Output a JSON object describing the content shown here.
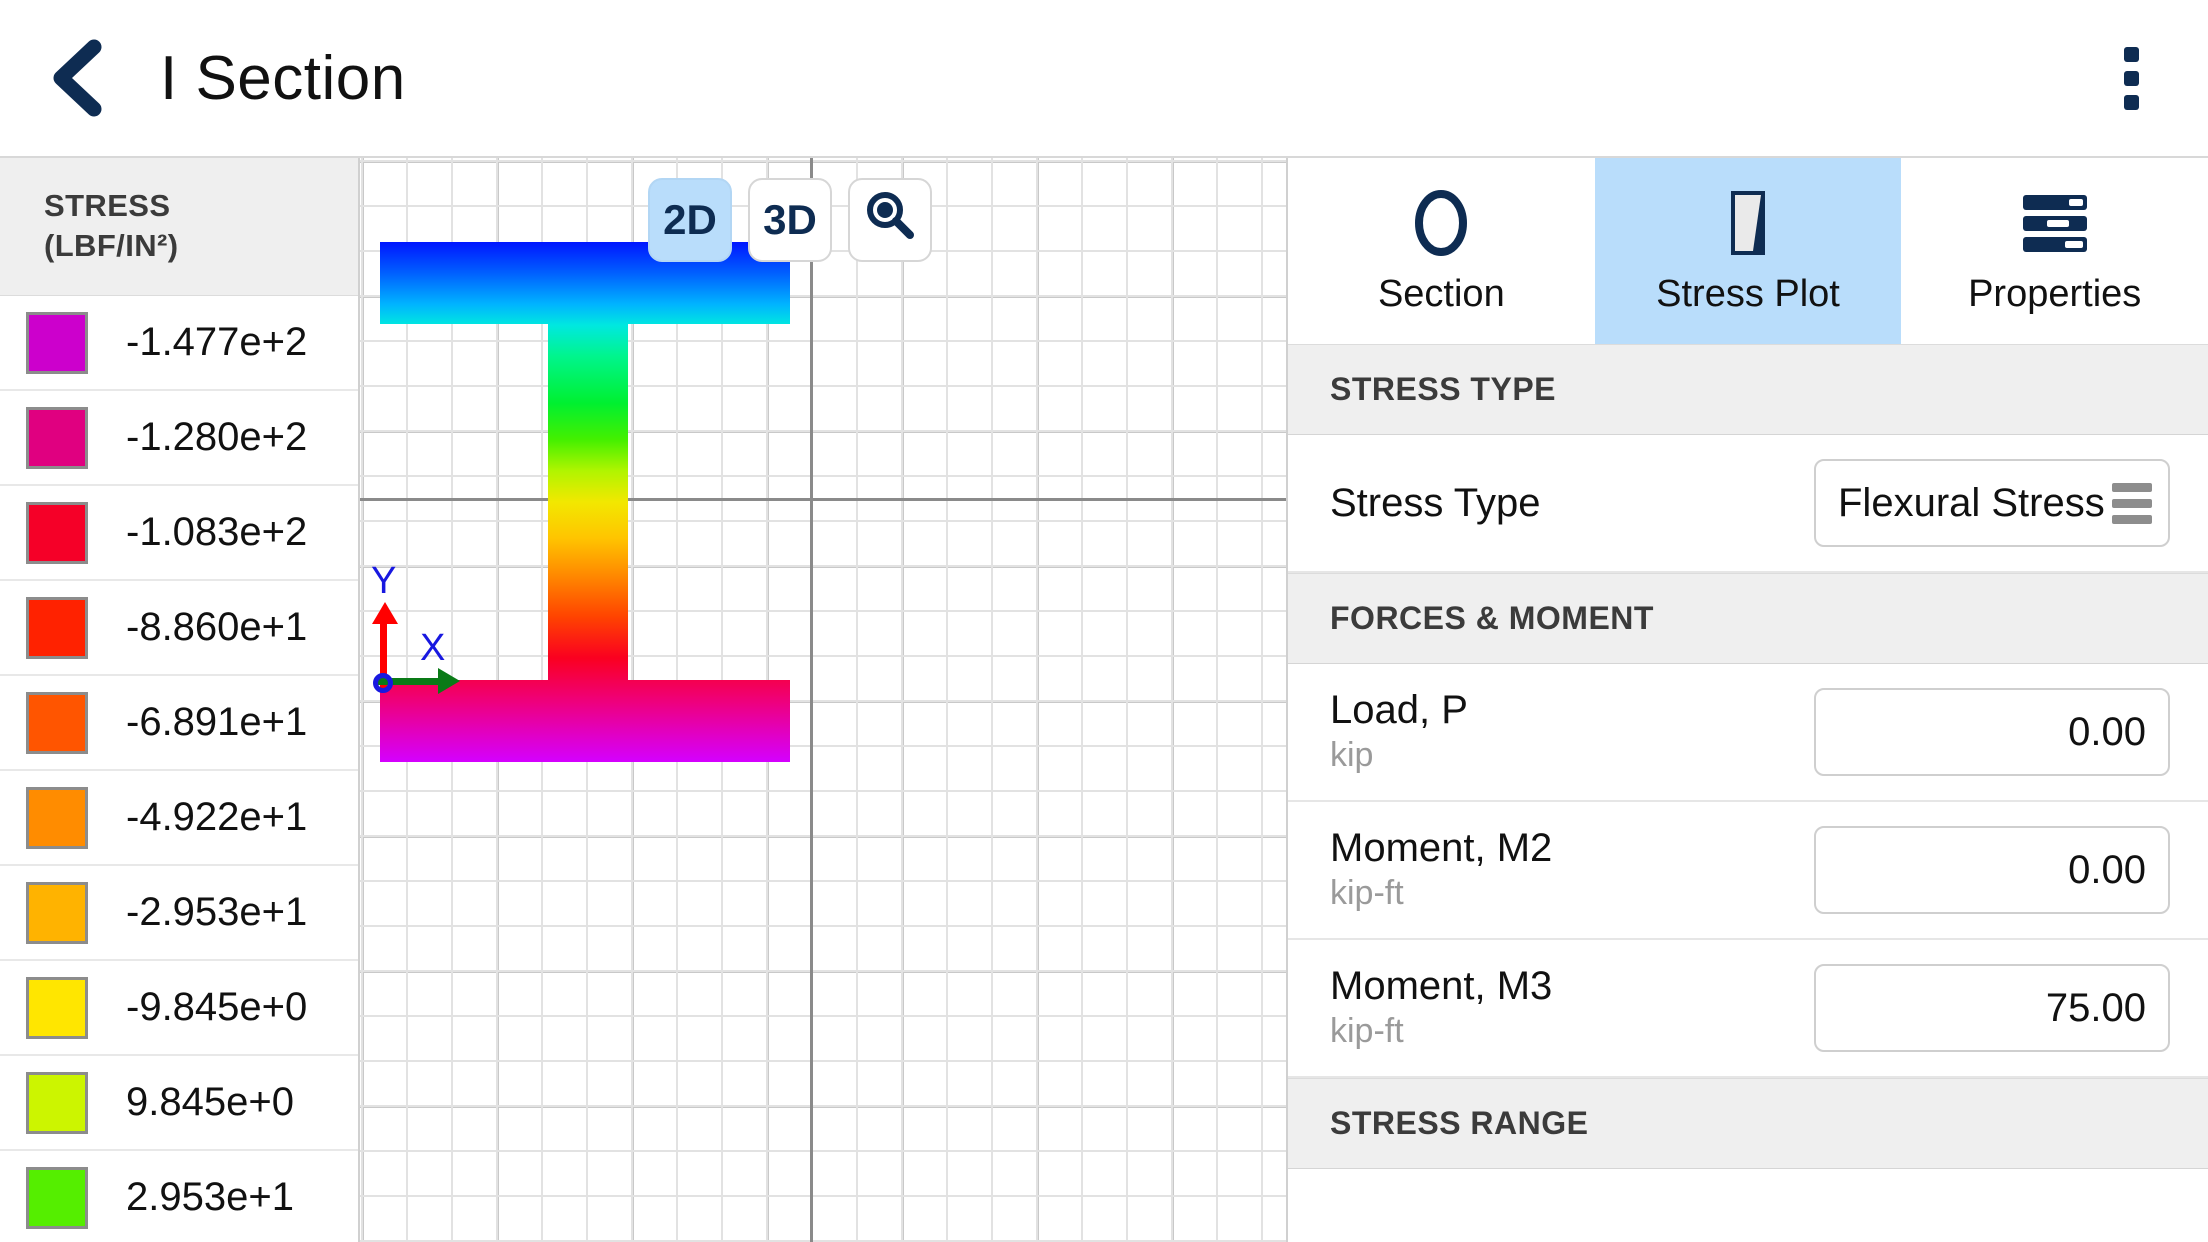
{
  "header": {
    "back_icon": "chevron-left-icon",
    "title": "I Section",
    "overflow_icon": "more-vertical-icon"
  },
  "legend": {
    "title_line1": "STRESS",
    "title_line2": "(LBF/IN²)",
    "rows": [
      {
        "color": "#cc00cc",
        "value": "-1.477e+2"
      },
      {
        "color": "#e00080",
        "value": "-1.280e+2"
      },
      {
        "color": "#f50028",
        "value": "-1.083e+2"
      },
      {
        "color": "#ff2200",
        "value": "-8.860e+1"
      },
      {
        "color": "#ff5500",
        "value": "-6.891e+1"
      },
      {
        "color": "#ff8c00",
        "value": "-4.922e+1"
      },
      {
        "color": "#ffb300",
        "value": "-2.953e+1"
      },
      {
        "color": "#ffe600",
        "value": "-9.845e+0"
      },
      {
        "color": "#ccf500",
        "value": "9.845e+0"
      },
      {
        "color": "#55ee00",
        "value": "2.953e+1"
      }
    ]
  },
  "viewport": {
    "buttons": [
      {
        "label": "2D",
        "name": "view-2d-button",
        "active": true
      },
      {
        "label": "3D",
        "name": "view-3d-button",
        "active": false
      }
    ],
    "zoom_icon": "magnifier-icon",
    "axis_x_label": "X",
    "axis_y_label": "Y"
  },
  "panel": {
    "tabs": [
      {
        "label": "Section",
        "icon": "ellipse-outline-icon",
        "active": false
      },
      {
        "label": "Stress Plot",
        "icon": "stress-plot-icon",
        "active": true
      },
      {
        "label": "Properties",
        "icon": "properties-list-icon",
        "active": false
      }
    ],
    "stress_type_section": {
      "header": "STRESS TYPE",
      "field_label": "Stress Type",
      "field_value": "Flexural Stress",
      "menu_icon": "hamburger-icon"
    },
    "forces_section": {
      "header": "FORCES & MOMENT",
      "fields": [
        {
          "name": "Load, P",
          "unit": "kip",
          "value": "0.00"
        },
        {
          "name": "Moment, M2",
          "unit": "kip-ft",
          "value": "0.00"
        },
        {
          "name": "Moment, M3",
          "unit": "kip-ft",
          "value": "75.00"
        }
      ]
    },
    "stress_range_section": {
      "header": "STRESS RANGE"
    }
  },
  "colors": {
    "accent_navy": "#0e2c52",
    "active_tab_bg": "#b9ddfb",
    "section_header_bg": "#efefef"
  }
}
